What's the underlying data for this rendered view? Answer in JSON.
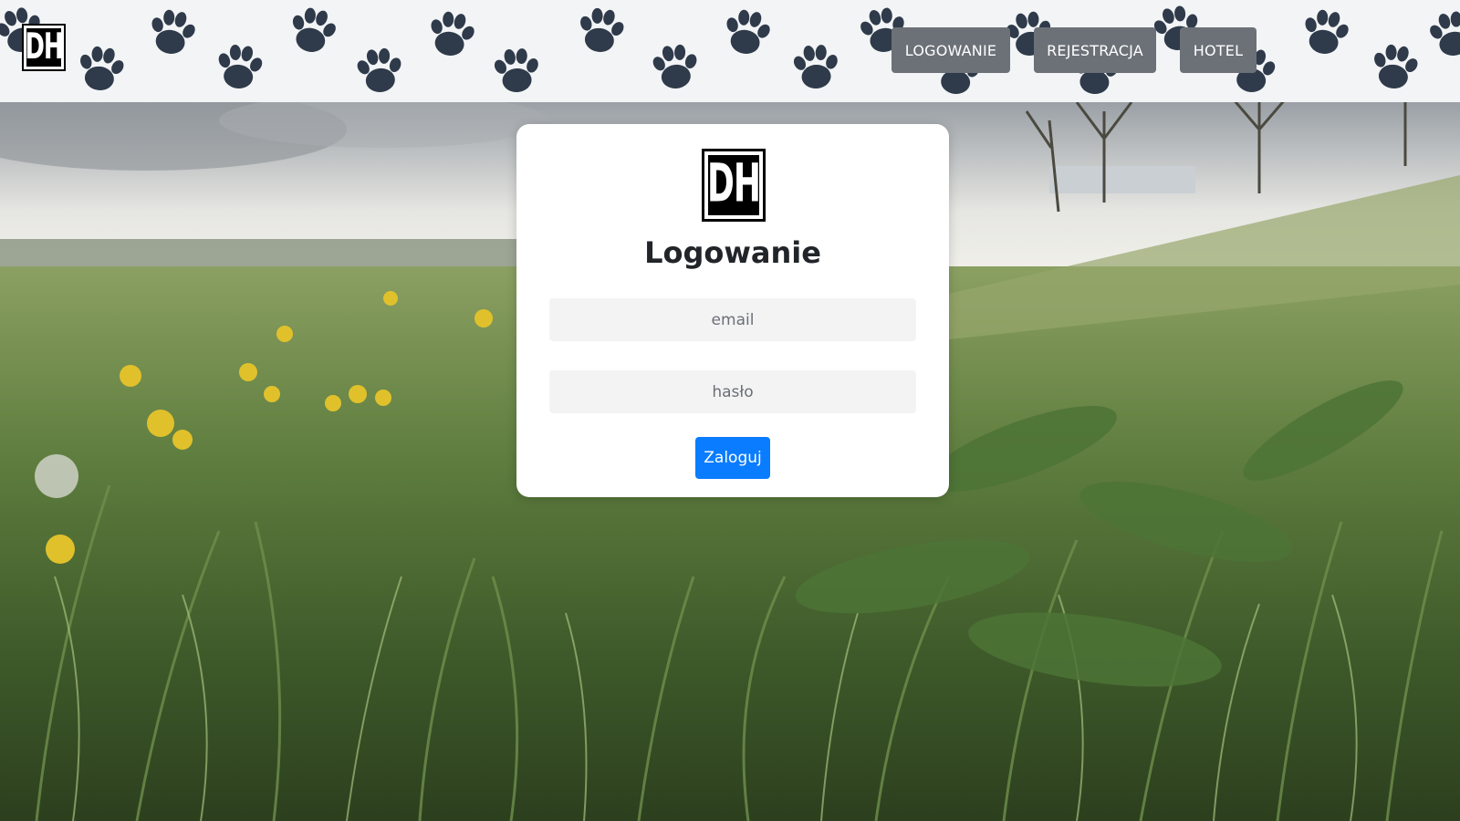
{
  "brand": {
    "logo_text": "DH"
  },
  "nav": {
    "items": [
      {
        "label": "LOGOWANIE"
      },
      {
        "label": "REJESTRACJA"
      },
      {
        "label": "HOTEL"
      }
    ]
  },
  "login": {
    "title": "Logowanie",
    "email_placeholder": "email",
    "password_placeholder": "hasło",
    "submit_label": "Zaloguj"
  },
  "colors": {
    "header_bg": "#f2f4f6",
    "paw": "#2f3a4a",
    "nav_button": "#6c7178",
    "primary": "#0a7cff"
  },
  "icons": {
    "header_pattern": "paw-print-icon"
  }
}
